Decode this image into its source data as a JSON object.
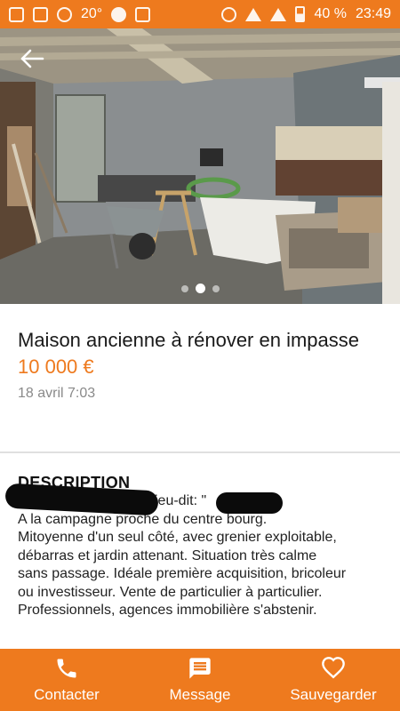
{
  "status_bar": {
    "temperature": "20°",
    "battery": "40 %",
    "time": "23:49"
  },
  "listing": {
    "title": "Maison ancienne à rénover en impasse",
    "price": "10 000 €",
    "date": "18 avril 7:03"
  },
  "gallery": {
    "active_index": 1,
    "count": 3
  },
  "description": {
    "heading": "DESCRIPTION",
    "first_line_fragment": "ieu-dit: \"",
    "lines": [
      "A la campagne proche du centre bourg.",
      "Mitoyenne d'un seul côté, avec grenier exploitable,",
      "débarras et jardin attenant. Situation très calme",
      "sans passage. Idéale première acquisition, bricoleur",
      "ou investisseur. Vente de particulier à particulier.",
      "Professionnels, agences immobilière s'abstenir."
    ]
  },
  "actions": {
    "contact_label": "Contacter",
    "message_label": "Message",
    "save_label": "Sauvegarder"
  },
  "colors": {
    "accent": "#ee7a1e"
  }
}
